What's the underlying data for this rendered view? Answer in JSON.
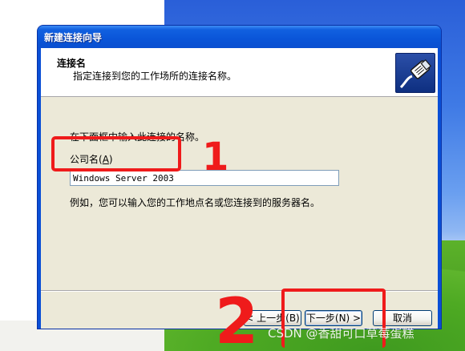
{
  "window": {
    "title": "新建连接向导"
  },
  "header": {
    "title": "连接名",
    "subtitle": "指定连接到您的工作场所的连接名称。",
    "icon": "network-cable-icon"
  },
  "body": {
    "instruction": "在下面框中输入此连接的名称。",
    "company_label": "公司名(",
    "company_label_key": "A",
    "company_label_end": ")",
    "company_value": "Windows Server 2003",
    "example": "例如，您可以输入您的工作地点名或您连接到的服务器名。"
  },
  "buttons": {
    "back": "< 上一步(B)",
    "next": "下一步(N) >",
    "cancel": "取消"
  },
  "annotations": {
    "step1": "1",
    "step2": "2",
    "color": "#ef1b1b"
  },
  "watermark": "CSDN @香甜可口草莓蛋糕"
}
